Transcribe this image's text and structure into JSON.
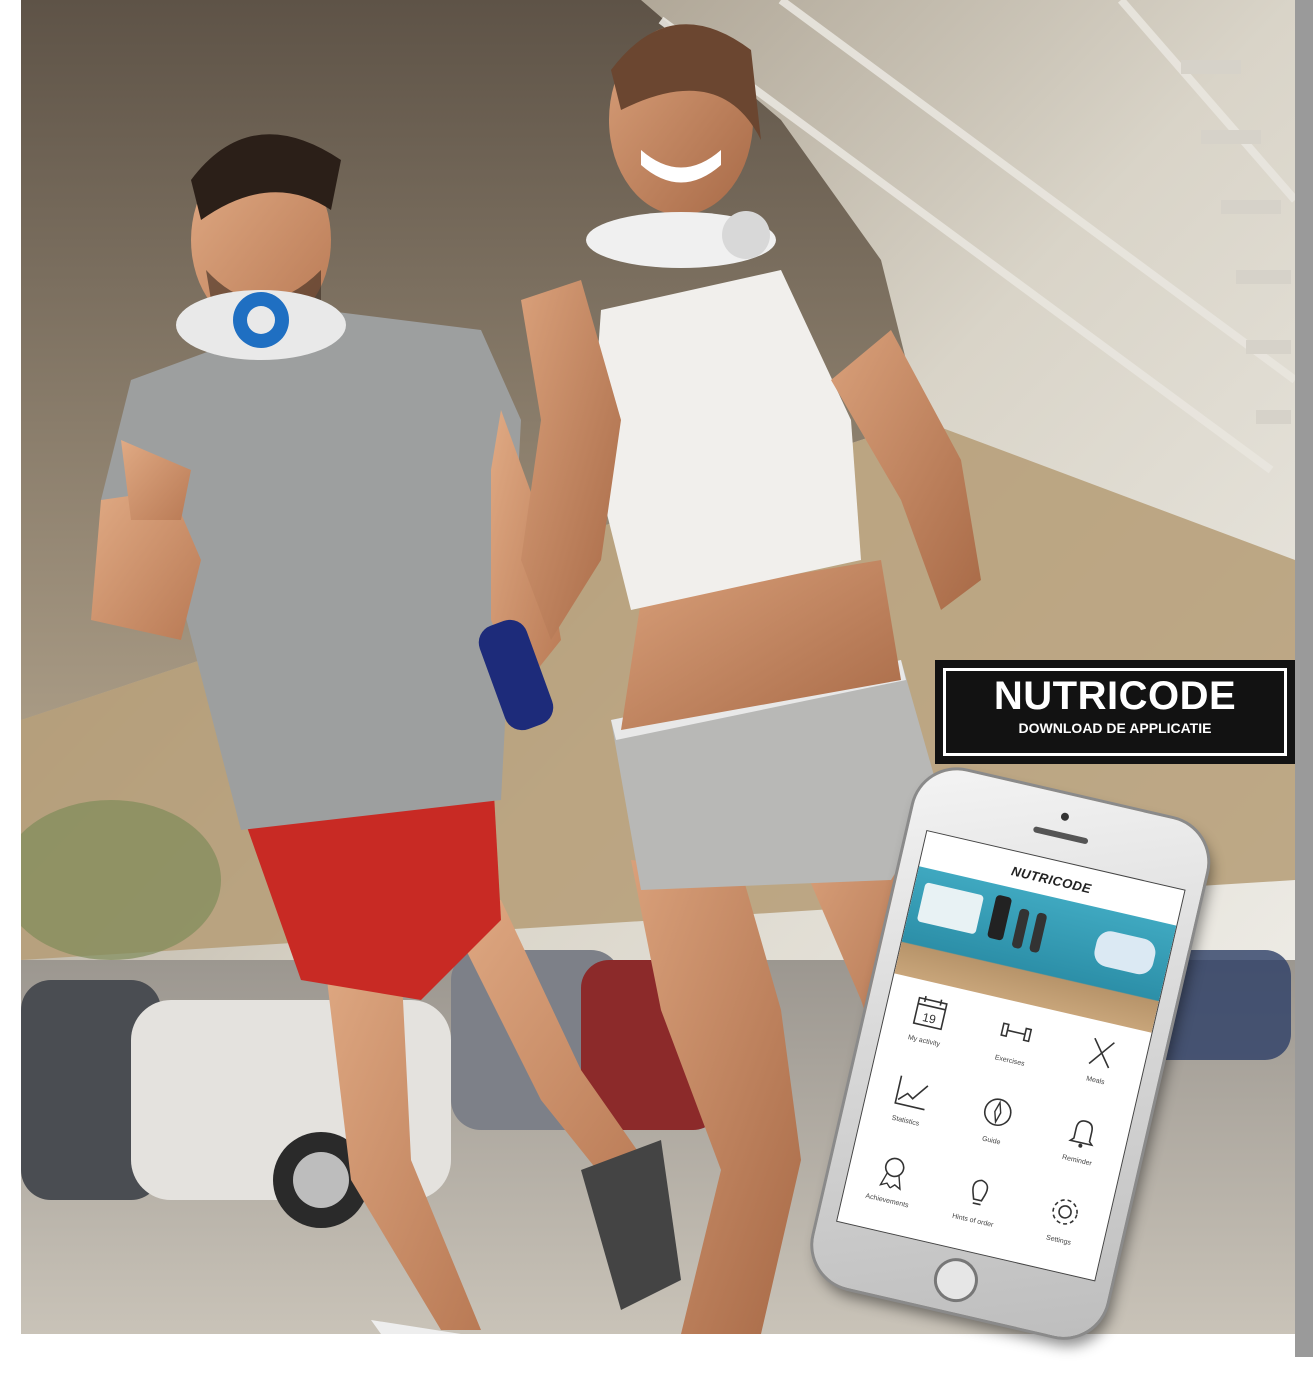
{
  "badge": {
    "title": "NUTRICODE",
    "subtitle": "DOWNLOAD DE APPLICATIE"
  },
  "phone": {
    "app_logo": "NUTRICODE",
    "menu": [
      {
        "label": "My activity",
        "icon": "calendar-icon",
        "day": "19"
      },
      {
        "label": "Exercises",
        "icon": "dumbbell-icon"
      },
      {
        "label": "Meals",
        "icon": "fork-knife-icon"
      },
      {
        "label": "Statistics",
        "icon": "chart-icon"
      },
      {
        "label": "Guide",
        "icon": "compass-icon"
      },
      {
        "label": "Reminder",
        "icon": "bell-icon"
      },
      {
        "label": "Achievements",
        "icon": "award-icon"
      },
      {
        "label": "Hints of order",
        "icon": "lightbulb-icon"
      },
      {
        "label": "Settings",
        "icon": "gear-icon"
      }
    ]
  },
  "colors": {
    "badge_bg": "#121212",
    "badge_text": "#ffffff",
    "right_strip": "#9a9a9a"
  }
}
